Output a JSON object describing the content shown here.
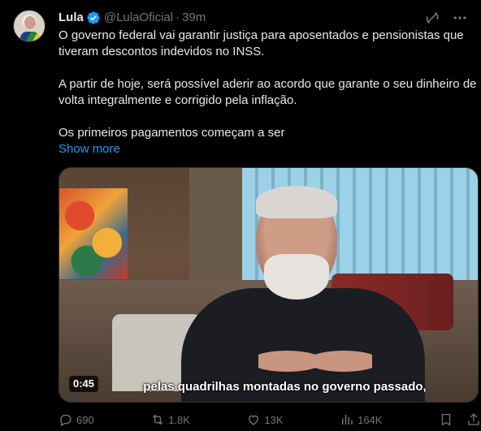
{
  "author": {
    "name": "Lula",
    "handle": "@LulaOficial",
    "separator": "·",
    "time": "39m"
  },
  "tweet": {
    "paragraphs": [
      "O governo federal vai garantir justiça para aposentados e pensionistas que tiveram descontos indevidos no INSS.",
      "A partir de hoje, será possível aderir ao acordo que garante o seu dinheiro de volta integralmente e corrigido pela inflação.",
      "Os primeiros pagamentos começam a ser"
    ],
    "show_more": "Show more"
  },
  "media": {
    "duration": "0:45",
    "subtitle": "pelas quadrilhas montadas no governo passado,"
  },
  "actions": {
    "replies": "690",
    "reposts": "1.8K",
    "likes": "13K",
    "views": "164K"
  },
  "icons": {
    "verified": "verified-badge-icon",
    "grok": "grok-icon",
    "more": "more-icon",
    "reply": "reply-icon",
    "repost": "repost-icon",
    "like": "like-icon",
    "views": "views-icon",
    "bookmark": "bookmark-icon",
    "share": "share-icon"
  },
  "colors": {
    "background": "#000000",
    "text": "#e7e9ea",
    "muted": "#71767b",
    "link": "#1d9bf0"
  }
}
